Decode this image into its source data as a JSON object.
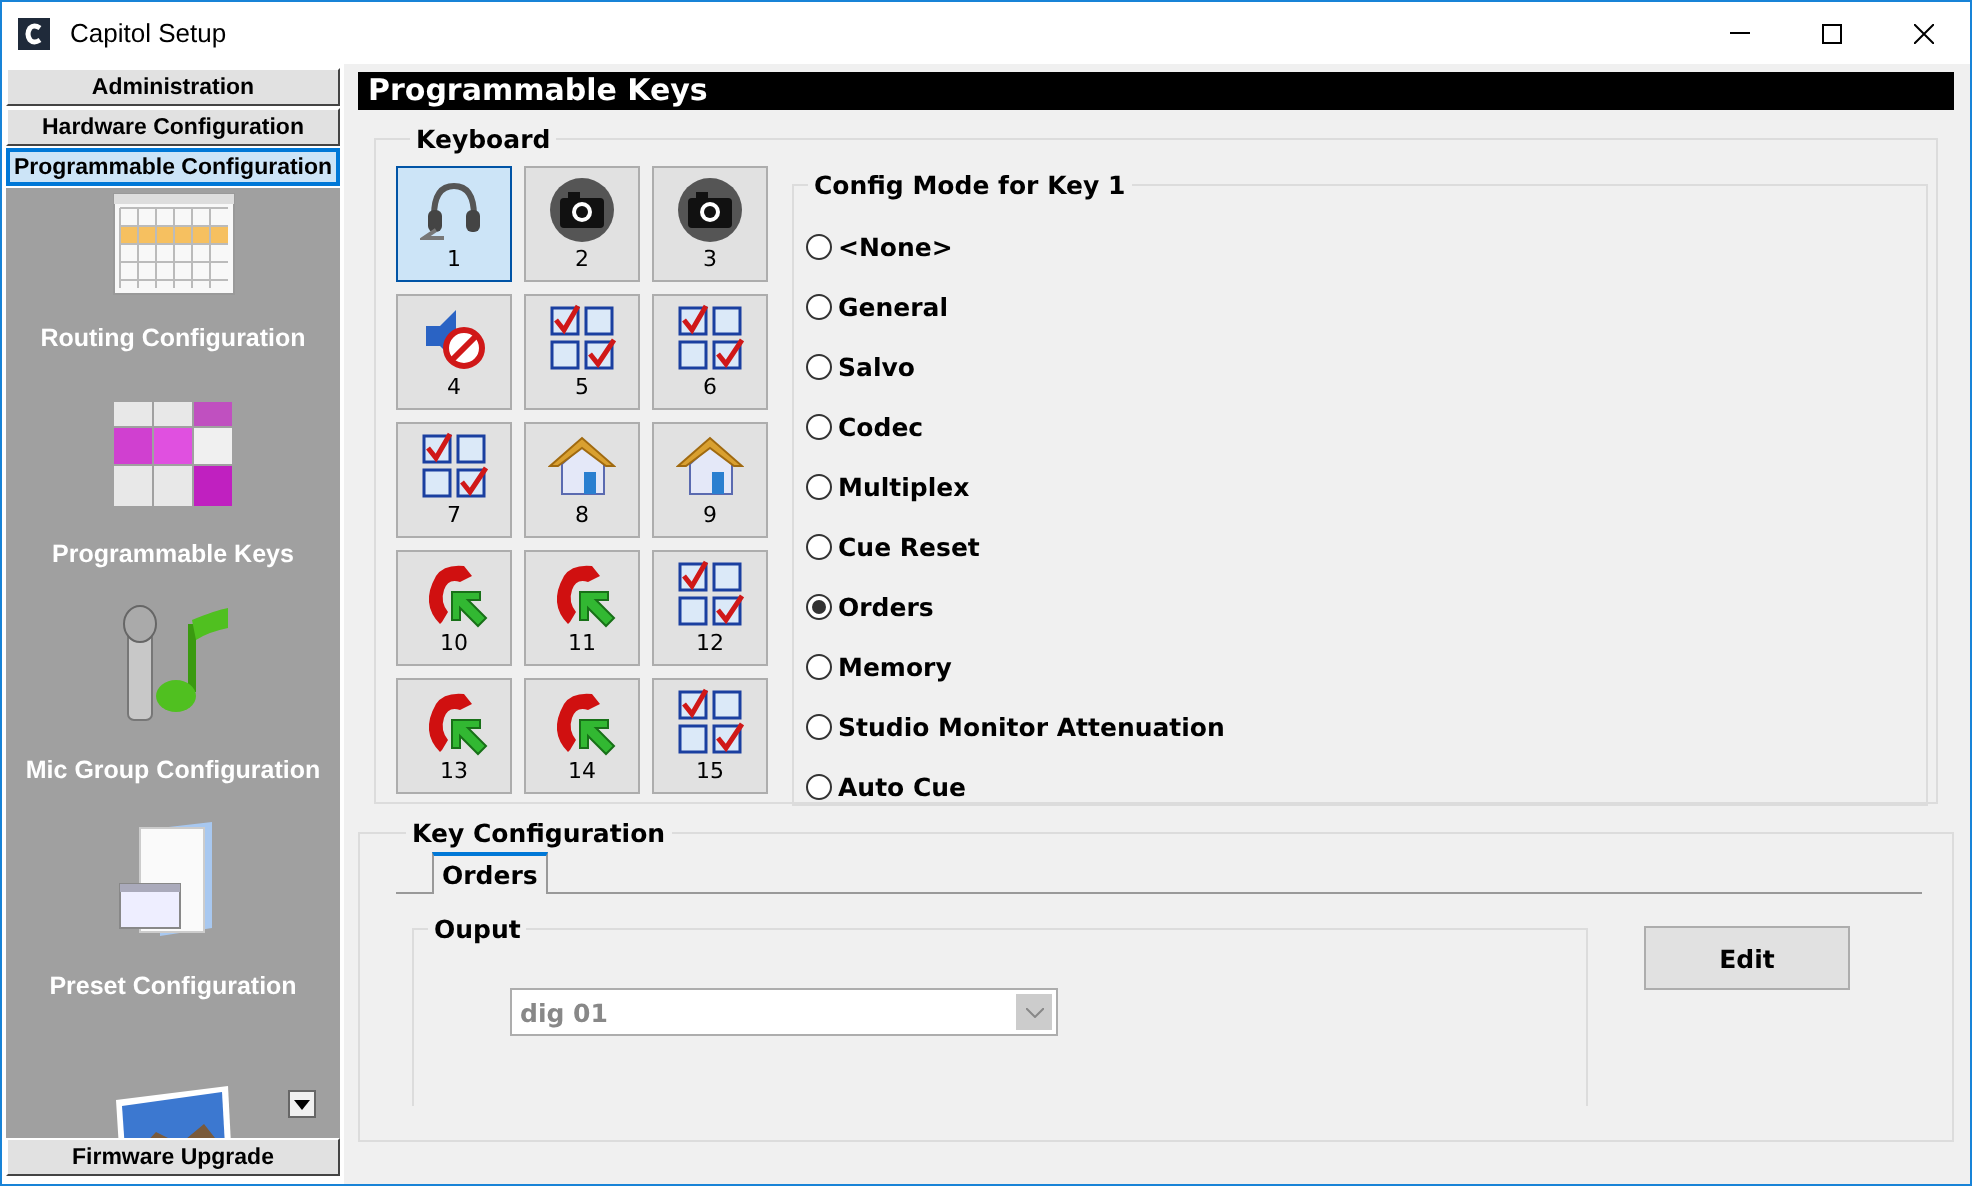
{
  "window": {
    "title": "Capitol Setup"
  },
  "sidebar": {
    "sections": [
      {
        "label": "Administration",
        "selected": false
      },
      {
        "label": "Hardware Configuration",
        "selected": false
      },
      {
        "label": "Programmable Configuration",
        "selected": true
      }
    ],
    "items": [
      {
        "label": "Routing Configuration",
        "kind": "routing"
      },
      {
        "label": "Programmable Keys",
        "kind": "keys"
      },
      {
        "label": "Mic Group Configuration",
        "kind": "mic"
      },
      {
        "label": "Preset Configuration",
        "kind": "preset"
      },
      {
        "kind": "photo"
      }
    ],
    "bottom_sections": [
      {
        "label": "Firmware Upgrade",
        "selected": false
      }
    ]
  },
  "page": {
    "title": "Programmable Keys"
  },
  "keyboard": {
    "title": "Keyboard",
    "keys": [
      {
        "label": "1",
        "kind": "headset",
        "selected": true
      },
      {
        "label": "2",
        "kind": "camera",
        "selected": false
      },
      {
        "label": "3",
        "kind": "camera",
        "selected": false
      },
      {
        "label": "4",
        "kind": "mute",
        "selected": false
      },
      {
        "label": "5",
        "kind": "checklist",
        "selected": false
      },
      {
        "label": "6",
        "kind": "checklist",
        "selected": false
      },
      {
        "label": "7",
        "kind": "checklist",
        "selected": false
      },
      {
        "label": "8",
        "kind": "house",
        "selected": false
      },
      {
        "label": "9",
        "kind": "house",
        "selected": false
      },
      {
        "label": "10",
        "kind": "phone",
        "selected": false
      },
      {
        "label": "11",
        "kind": "phone",
        "selected": false
      },
      {
        "label": "12",
        "kind": "checklist",
        "selected": false
      },
      {
        "label": "13",
        "kind": "phone",
        "selected": false
      },
      {
        "label": "14",
        "kind": "phone",
        "selected": false
      },
      {
        "label": "15",
        "kind": "checklist",
        "selected": false
      }
    ]
  },
  "config_mode": {
    "title": "Config Mode for Key 1",
    "options": [
      {
        "label": "<None>",
        "selected": false
      },
      {
        "label": "General",
        "selected": false
      },
      {
        "label": "Salvo",
        "selected": false
      },
      {
        "label": "Codec",
        "selected": false
      },
      {
        "label": "Multiplex",
        "selected": false
      },
      {
        "label": "Cue Reset",
        "selected": false
      },
      {
        "label": "Orders",
        "selected": true
      },
      {
        "label": "Memory",
        "selected": false
      },
      {
        "label": "Studio Monitor Attenuation",
        "selected": false
      },
      {
        "label": "Auto Cue",
        "selected": false
      }
    ]
  },
  "key_configuration": {
    "title": "Key Configuration",
    "tabs": [
      {
        "label": "Orders",
        "selected": true
      }
    ],
    "output": {
      "title": "Ouput",
      "dropdown": {
        "value": "dig 01",
        "disabled": true
      }
    },
    "edit_button": "Edit"
  }
}
